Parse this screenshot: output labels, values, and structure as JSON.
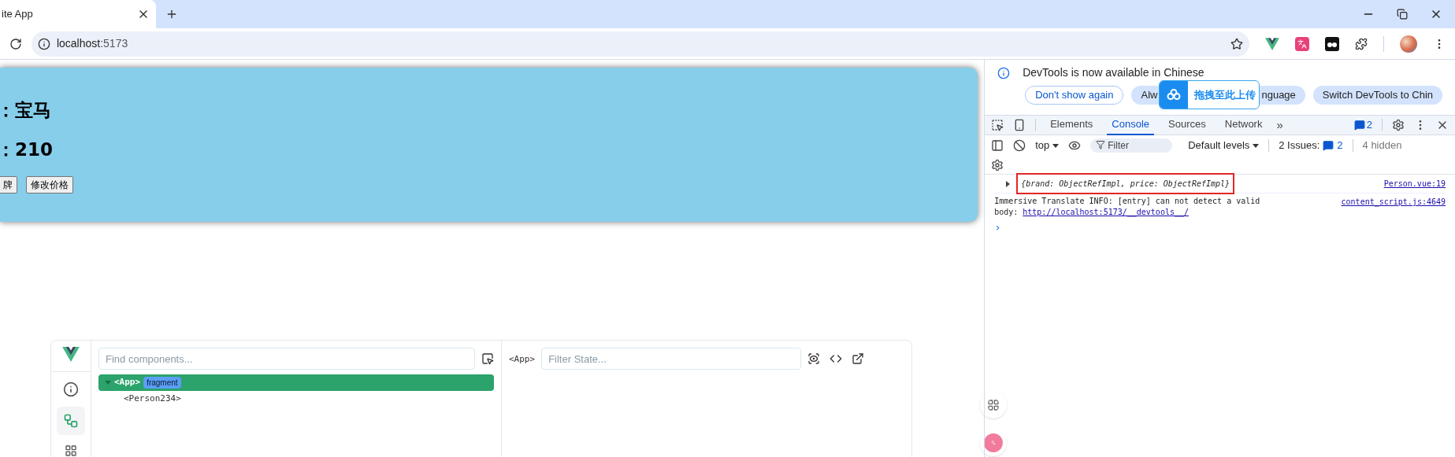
{
  "browser": {
    "tab_title": "ite App",
    "url_host": "localhost",
    "url_port": ":5173"
  },
  "page": {
    "lines": [
      "：宝马",
      "：210"
    ],
    "buttons": [
      "牌",
      "修改价格"
    ]
  },
  "vue_devtools": {
    "search": {
      "placeholder": "Find components..."
    },
    "tree": [
      {
        "label": "<App>",
        "badge": "fragment",
        "selected": true,
        "expanded": true,
        "children": [
          {
            "label": "<Person234>",
            "selected": false
          }
        ]
      }
    ],
    "state_tag": "<App>",
    "state_search": {
      "placeholder": "Filter State..."
    }
  },
  "devtools": {
    "banner": {
      "message": "DevTools is now available in Chinese",
      "buttons": [
        {
          "parts": [
            "Don't show again"
          ],
          "kind": "outline"
        },
        {
          "parts": [
            "Alw",
            "nguage"
          ],
          "kind": "filled"
        },
        {
          "parts": [
            "Switch DevTools to Chin"
          ],
          "kind": "filled"
        }
      ]
    },
    "upload_overlay": "拖拽至此上传",
    "tabs": [
      {
        "label": "Elements",
        "selected": false
      },
      {
        "label": "Console",
        "selected": true
      },
      {
        "label": "Sources",
        "selected": false
      },
      {
        "label": "Network",
        "selected": false
      }
    ],
    "more_tabs": "»",
    "issue_badge": "2",
    "context": "top",
    "filter": {
      "placeholder": "Filter"
    },
    "levels": "Default levels",
    "issues_label": "2 Issues:",
    "issues_count": "2",
    "hidden": "4 hidden",
    "messages": [
      {
        "kind": "object",
        "text": "{brand: ObjectRefImpl, price: ObjectRefImpl}",
        "source": "Person.vue:19",
        "highlighted": true
      },
      {
        "kind": "info",
        "text": "Immersive Translate INFO: [entry] can not detect a valid body: ",
        "link": "http://localhost:5173/__devtools__/",
        "source": "content_script.js:4649"
      }
    ],
    "prompt": "›"
  }
}
